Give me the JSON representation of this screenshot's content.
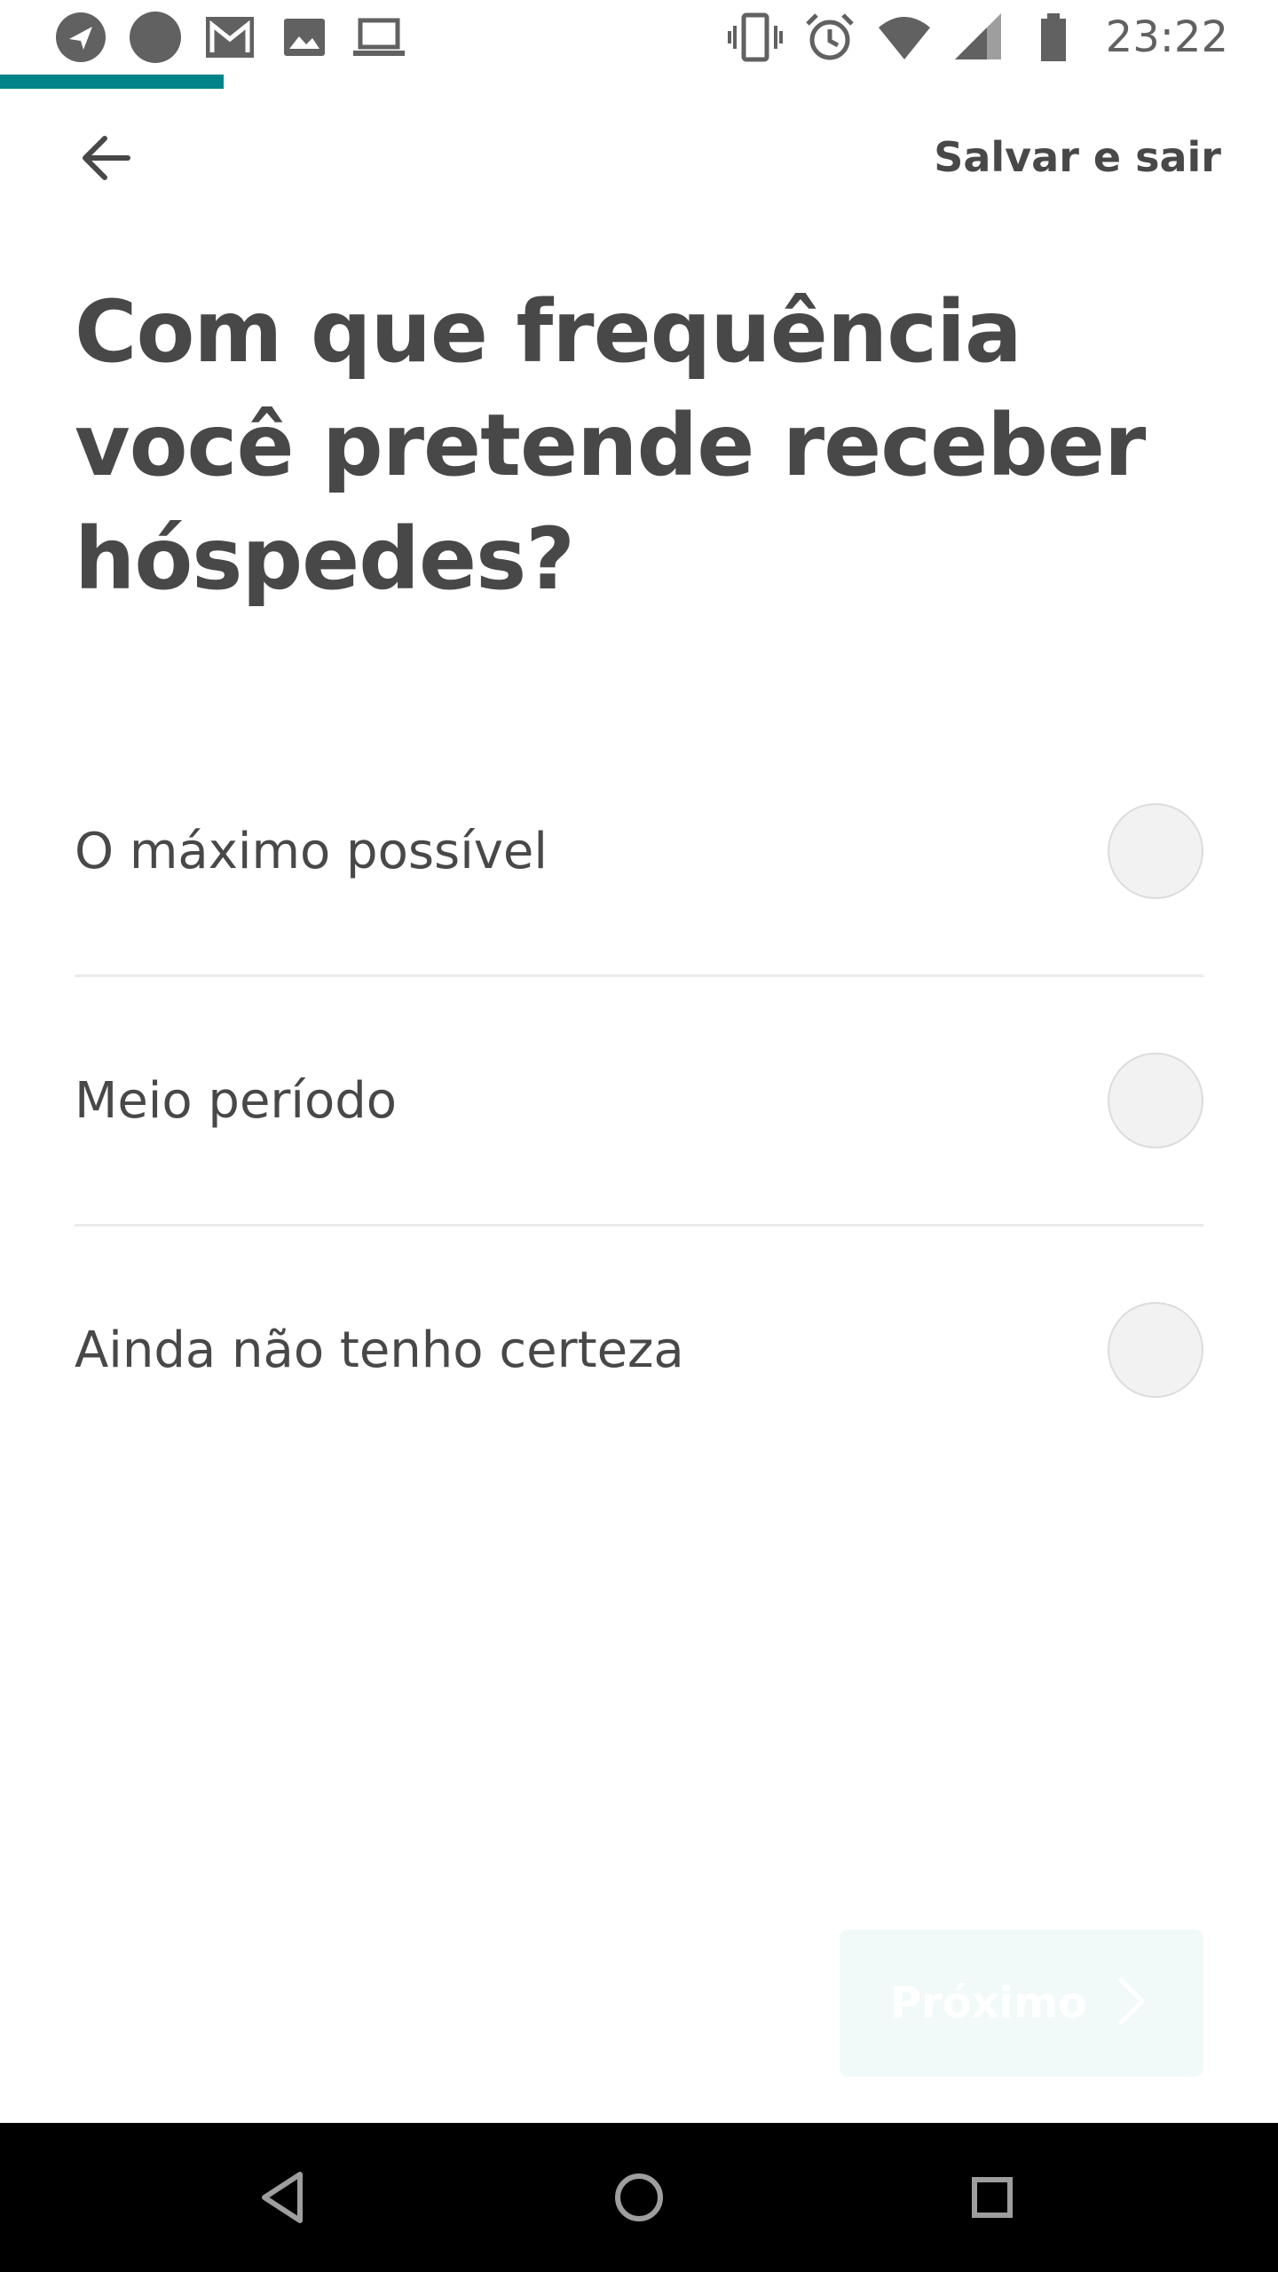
{
  "status_bar": {
    "time": "23:22",
    "left_icons": [
      "navigation-icon",
      "circle-icon",
      "gmail-icon",
      "image-icon",
      "laptop-icon"
    ],
    "right_icons": [
      "vibrate-icon",
      "alarm-icon",
      "wifi-icon",
      "signal-icon",
      "battery-icon"
    ]
  },
  "progress": {
    "value": 0.175,
    "color": "#008489"
  },
  "header": {
    "back_icon": "arrow-left-icon",
    "save_exit_label": "Salvar e sair"
  },
  "title": "Com que frequência você pretende receber hóspedes?",
  "options": [
    {
      "label": "O máximo possível",
      "selected": false
    },
    {
      "label": "Meio período",
      "selected": false
    },
    {
      "label": "Ainda não tenho certeza",
      "selected": false
    }
  ],
  "next_button": {
    "label": "Próximo",
    "icon": "chevron-right-icon",
    "enabled": false
  },
  "nav_bar": {
    "icons": [
      "back-triangle-icon",
      "home-circle-icon",
      "recents-square-icon"
    ]
  },
  "colors": {
    "text": "#484848",
    "accent": "#008489",
    "divider": "#EBEBEB",
    "disabled_button": "#F1F9F9"
  }
}
